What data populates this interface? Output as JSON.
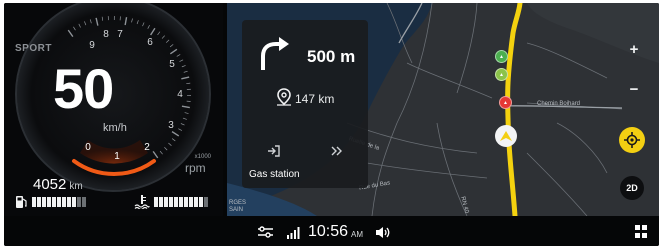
{
  "cluster": {
    "drive_mode": "SPORT",
    "speed": "50",
    "speed_unit": "km/h",
    "rpm_multiplier": "x1000",
    "rpm_unit": "rpm",
    "rpm_ticks": [
      "0",
      "1",
      "2",
      "3",
      "4",
      "5",
      "6",
      "7",
      "8",
      "9"
    ],
    "odometer": "4052",
    "odometer_unit": "km",
    "fuel_level_segments_on": 9,
    "coolant_level_segments_on": 10,
    "segments_total": 11,
    "accent_color": "#f05a16"
  },
  "navigation": {
    "maneuver_icon": "turn-right-icon",
    "distance_to_turn": "500 m",
    "remaining_distance": "147 km",
    "poi_label": "Gas station"
  },
  "map": {
    "street_labels": [
      "Chemin Boihard",
      "Ruelle de la",
      "Rue du Bas",
      "RN 40"
    ],
    "corner_label": "RGES\nSAIN"
  },
  "controls": {
    "zoom_in_label": "+",
    "zoom_out_label": "−",
    "view_mode_label": "2D"
  },
  "statusbar": {
    "time": "10:56",
    "ampm": "AM"
  },
  "colors": {
    "route": "#f4d20f",
    "locate_button": "#f3cf12",
    "traffic_green": "#4caf50",
    "traffic_light_green": "#8bc34a",
    "traffic_red": "#e53935"
  }
}
